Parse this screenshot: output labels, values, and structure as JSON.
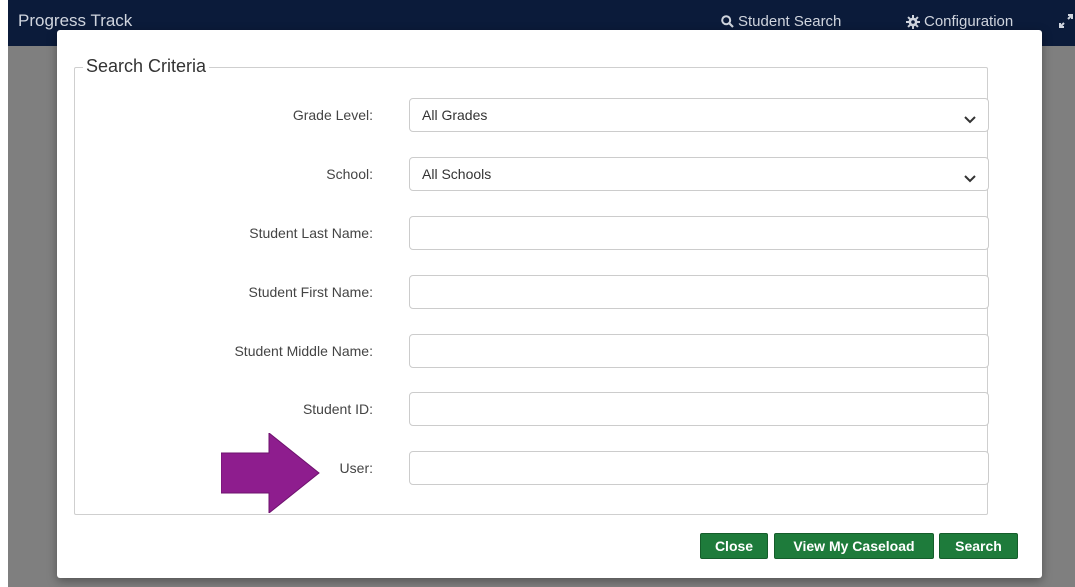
{
  "navbar": {
    "title": "Progress Track",
    "search_link": "Student Search",
    "config_link": "Configuration",
    "search_icon": "search-icon",
    "config_icon": "gear-icon",
    "expand_icon": "expand-icon"
  },
  "modal": {
    "legend": "Search Criteria",
    "fields": {
      "grade_level": {
        "label": "Grade Level:",
        "value": "All Grades"
      },
      "school": {
        "label": "School:",
        "value": "All Schools"
      },
      "last_name": {
        "label": "Student Last Name:",
        "value": ""
      },
      "first_name": {
        "label": "Student First Name:",
        "value": ""
      },
      "middle_name": {
        "label": "Student Middle Name:",
        "value": ""
      },
      "student_id": {
        "label": "Student ID:",
        "value": ""
      },
      "user": {
        "label": "User:",
        "value": ""
      }
    },
    "buttons": {
      "close": "Close",
      "caseload": "View My Caseload",
      "search": "Search"
    }
  },
  "colors": {
    "navbar": "#0b1b3a",
    "button_green": "#1e7b3b",
    "arrow_purple": "#8e1d8e"
  }
}
